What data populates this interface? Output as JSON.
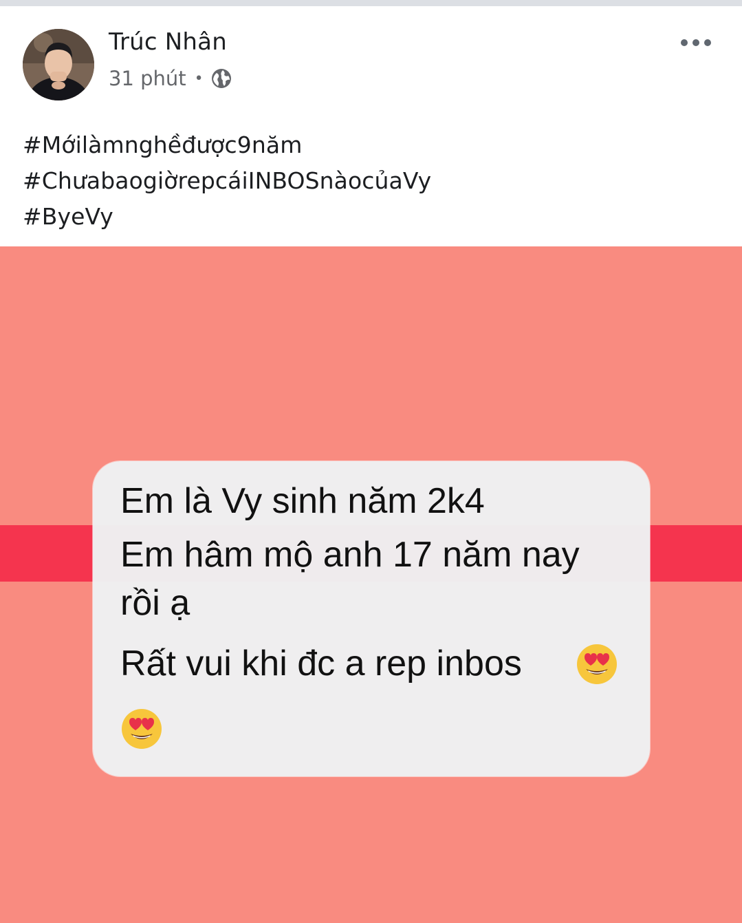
{
  "post": {
    "author_name": "Trúc Nhân",
    "timestamp": "31 phút",
    "separator": "•",
    "privacy_icon": "globe-icon",
    "more_icon": "more-dots-icon",
    "hashtags": [
      "#Mớilàmnghềđược9năm",
      "#ChưabaogiờrepcáiINBOSnàocủaVy",
      "#ByeVy"
    ]
  },
  "photo": {
    "background_color": "#f98b80",
    "stripe_color": "#f5344e",
    "message": {
      "lines": [
        "Em là Vy sinh năm 2k4",
        "Em hâm mộ anh 17 năm nay",
        "rồi ạ",
        "Rất vui khi đc a rep inbos"
      ],
      "emoji": "heart-eyes-emoji"
    }
  }
}
